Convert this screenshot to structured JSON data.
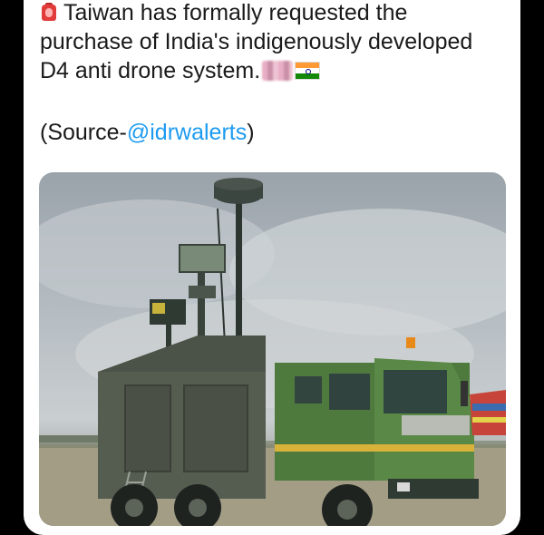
{
  "tweet": {
    "line1": "Taiwan has formally requested the",
    "line2": "purchase of India's indigenously developed",
    "line3": "D4 anti drone system.",
    "source_prefix": "(Source-",
    "source_handle": "@idrwalerts",
    "source_suffix": ")"
  },
  "icons": {
    "alarm": "police-light-icon",
    "blurred": "blurred-emoji-icon",
    "flag": "india-flag-icon"
  },
  "media": {
    "description_alt": "Green military truck with D4 anti drone system equipment"
  },
  "colors": {
    "background": "#000000",
    "card": "#ffffff",
    "text": "#1a1a1a",
    "link": "#1d9bf0"
  }
}
